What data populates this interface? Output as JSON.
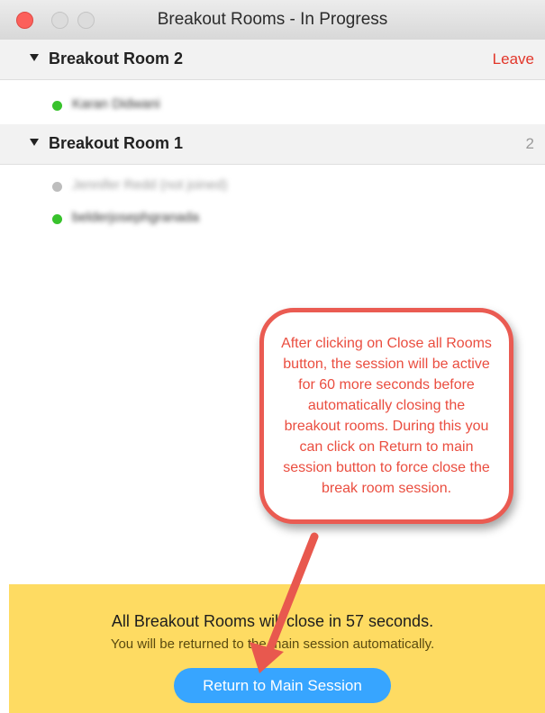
{
  "window": {
    "title": "Breakout Rooms - In Progress"
  },
  "rooms": [
    {
      "name": "Breakout Room 2",
      "action_label": "Leave",
      "members": [
        {
          "name": "Karan Didwani",
          "status": "joined"
        }
      ]
    },
    {
      "name": "Breakout Room 1",
      "count": "2",
      "members": [
        {
          "name": "Jennifer Redd (not joined)",
          "status": "not-joined"
        },
        {
          "name": "belderjosephgranada",
          "status": "joined"
        }
      ]
    }
  ],
  "annotation": {
    "text": "After clicking on Close all Rooms button, the session will be active for 60 more seconds before automatically closing the breakout rooms. During this you can click on Return to main session button to force close the break room session."
  },
  "footer": {
    "close_notice": "All Breakout Rooms will close in 57 seconds.",
    "return_notice": "You will be returned to the main session automatically.",
    "return_button_label": "Return to Main Session"
  },
  "colors": {
    "accent_blue": "#37a5ff",
    "leave_red": "#e2362a",
    "online_green": "#38c22c",
    "offline_gray": "#bdbdbd",
    "banner_yellow": "#fedb62",
    "callout_red": "#ea5b52"
  }
}
